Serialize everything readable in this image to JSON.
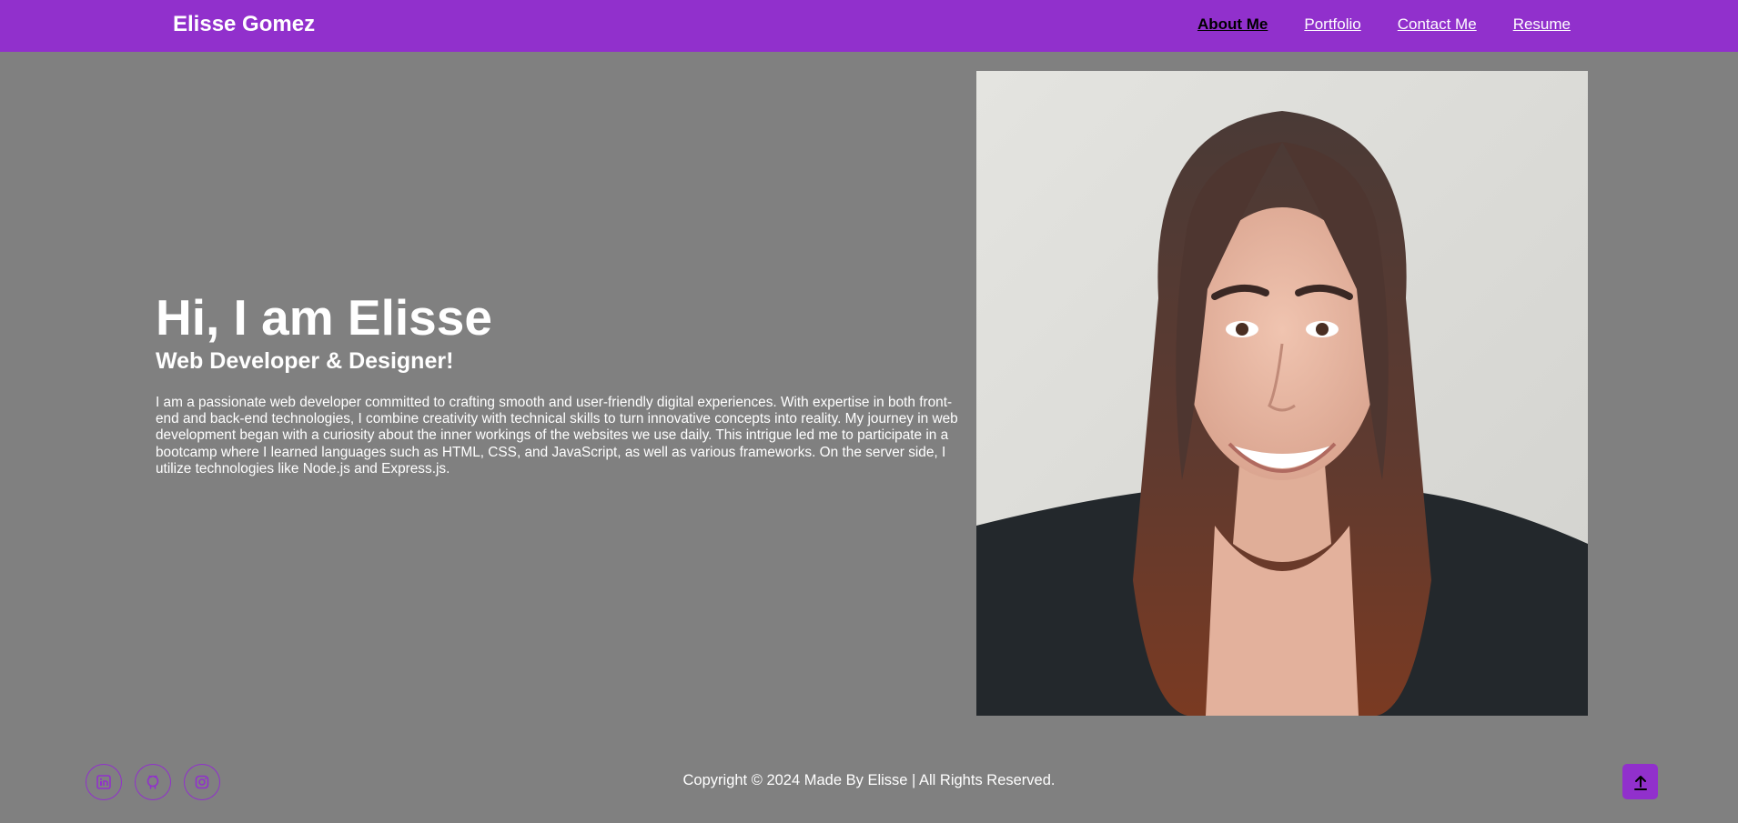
{
  "header": {
    "brand": "Elisse Gomez",
    "nav": [
      {
        "label": "About Me",
        "active": true
      },
      {
        "label": "Portfolio",
        "active": false
      },
      {
        "label": "Contact Me",
        "active": false
      },
      {
        "label": "Resume",
        "active": false
      }
    ]
  },
  "hero": {
    "heading": "Hi, I am Elisse",
    "subheading": "Web Developer & Designer!",
    "bio": "I am a passionate web developer committed to crafting smooth and user-friendly digital experiences. With expertise in both front-end and back-end technologies, I combine creativity with technical skills to turn innovative concepts into reality. My journey in web development began with a curiosity about the inner workings of the websites we use daily. This intrigue led me to participate in a bootcamp where I learned languages such as HTML, CSS, and JavaScript, as well as various frameworks. On the server side, I utilize technologies like Node.js and Express.js."
  },
  "footer": {
    "copyright": "Copyright © 2024 Made By Elisse | All Rights Reserved.",
    "social_icons": [
      "linkedin-icon",
      "github-icon",
      "instagram-icon"
    ]
  },
  "colors": {
    "accent": "#9130cc",
    "background": "#808080",
    "active_link": "#000000"
  }
}
